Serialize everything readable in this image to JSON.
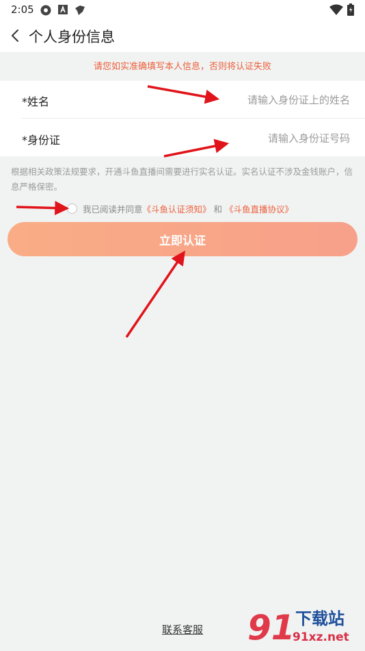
{
  "status_bar": {
    "time": "2:05",
    "left_icons": [
      "shutter-icon",
      "a-badge-icon",
      "app-icon"
    ],
    "right_icons": [
      "wifi-icon",
      "battery-icon"
    ]
  },
  "app_bar": {
    "back_icon": "chevron-left-icon",
    "title": "个人身份信息"
  },
  "warning": "请您如实准确填写本人信息，否则将认证失败",
  "form": {
    "name_label": "*姓名",
    "name_placeholder": "请输入身份证上的姓名",
    "id_label": "*身份证",
    "id_placeholder": "请输入身份证号码"
  },
  "notice": "根据相关政策法规要求，开通斗鱼直播间需要进行实名认证。实名认证不涉及金钱账户，信息严格保密。",
  "agreement": {
    "prefix": "我已阅读并同意",
    "link1": "《斗鱼认证须知》",
    "middle": " 和 ",
    "link2": "《斗鱼直播协议》",
    "checked": false
  },
  "verify_button": "立即认证",
  "contact_link": "联系客服",
  "watermark": {
    "logo": "91",
    "text": "下载站",
    "url": "91xz.net"
  },
  "colors": {
    "accent": "#ec5f3a",
    "button_gradient_start": "#f9ac85",
    "button_gradient_end": "#f7a08a",
    "annotation_arrow": "#e0141a",
    "background": "#f1f3f3"
  }
}
